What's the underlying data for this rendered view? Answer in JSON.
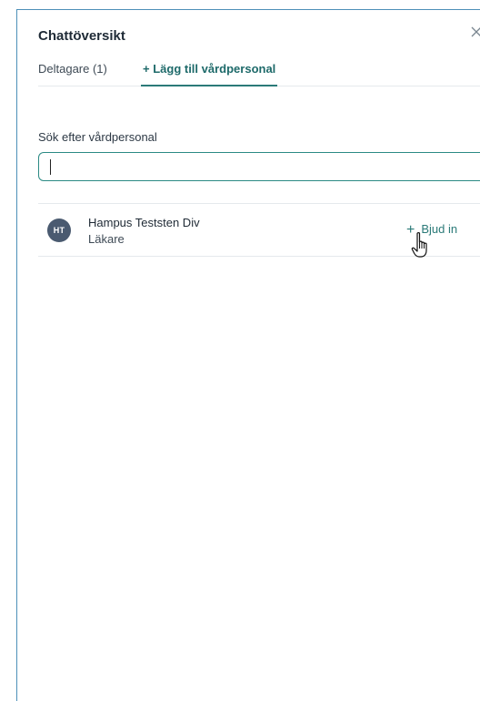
{
  "panel": {
    "title": "Chattöversikt",
    "close_icon": "close-icon"
  },
  "tabs": [
    {
      "label": "Deltagare (1)",
      "active": false
    },
    {
      "label": "+ Lägg till vårdpersonal",
      "active": true
    }
  ],
  "search": {
    "label": "Sök efter vårdpersonal",
    "value": "",
    "placeholder": "",
    "dropdown_icon": "chevron-down-icon"
  },
  "results": [
    {
      "initials": "HT",
      "name": "Hampus Teststen Div",
      "role": "Läkare",
      "invite_label": "Bjud in",
      "invite_icon": "plus-icon"
    }
  ],
  "colors": {
    "accent": "#2b7a78",
    "panel_border": "#4d90b8",
    "avatar_bg": "#4a5a70",
    "divider": "#e5e9ec"
  }
}
